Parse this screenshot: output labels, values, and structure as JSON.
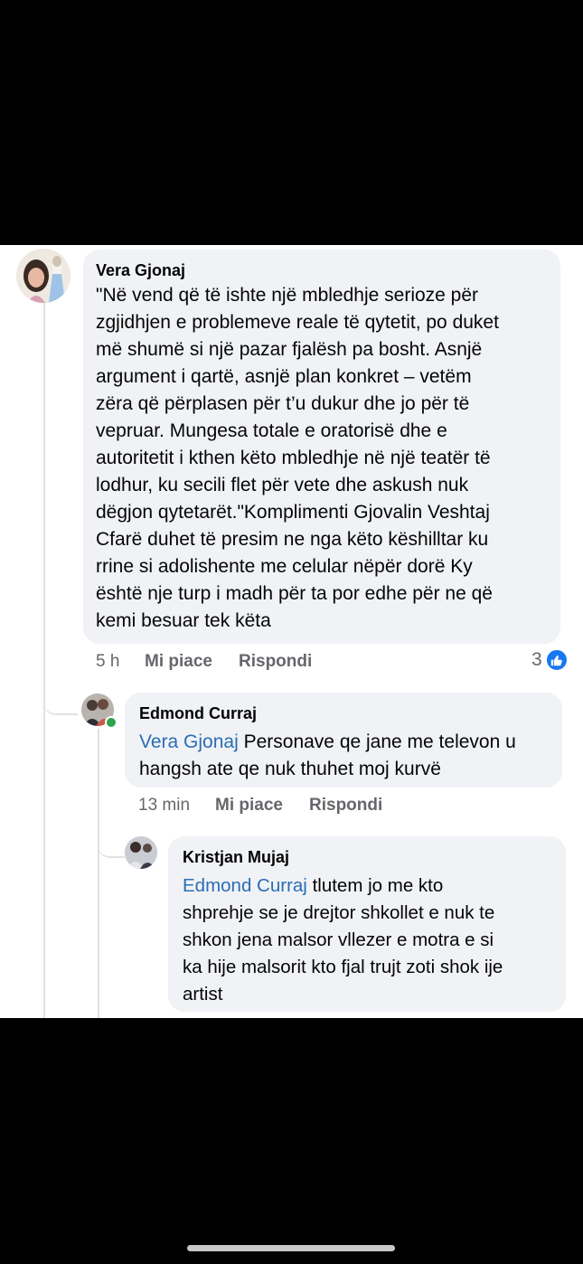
{
  "comment": {
    "author": "Vera Gjonaj",
    "lines": [
      "\"Në vend që të ishte një mbledhje serioze për",
      "zgjidhjen e problemeve reale të qytetit, po duket",
      "më shumë si një pazar fjalësh pa bosht. Asnjë",
      "argument i qartë, asnjë plan konkret – vetëm",
      "zëra që përplasen për t’u dukur dhe jo për të",
      "vepruar. Mungesa totale e oratorisë dhe e",
      "autoritetit i kthen këto mbledhje në një teatër të",
      "lodhur, ku secili flet për vete dhe askush nuk",
      "dëgjon qytetarët.\"Komplimenti Gjovalin Veshtaj",
      "Cfarë duhet të presim ne nga këto këshilltar ku",
      "rrine si adolishente me celular nëpër dorë Ky",
      "është nje turp i madh për ta por edhe për ne që",
      "kemi besuar tek këta"
    ],
    "time": "5 h",
    "like_label": "Mi piace",
    "reply_label": "Rispondi",
    "reaction_count": "3"
  },
  "reply1": {
    "author": "Edmond Curraj",
    "mention": "Vera Gjonaj",
    "line1_rest": " Personave qe jane me televon u",
    "line2": "hangsh ate qe nuk thuhet moj kurvë",
    "time": "13 min",
    "like_label": "Mi piace",
    "reply_label": "Rispondi"
  },
  "reply2": {
    "author": "Kristjan Mujaj",
    "mention": "Edmond Curraj",
    "line1_rest": " tlutem jo me kto",
    "lines": [
      "shprehje se je drejtor shkollet e nuk te",
      "shkon jena malsor vllezer e motra e si",
      "ka hije malsorit kto fjal trujt zoti shok ije",
      "artist"
    ]
  },
  "colors": {
    "mention": "#2a6db5",
    "like": "#1877f2",
    "bubble": "#f0f2f5",
    "online": "#31a24c"
  }
}
